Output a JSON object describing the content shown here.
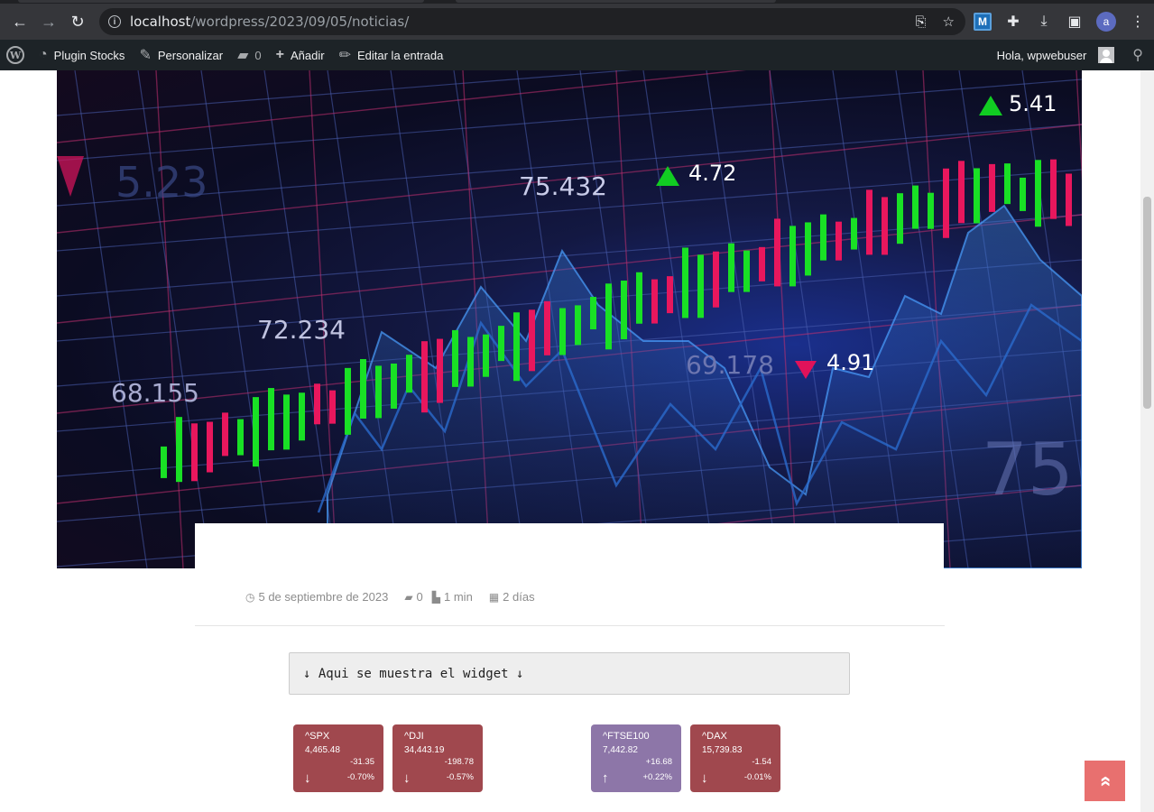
{
  "browser": {
    "url_host": "localhost",
    "url_path": "/wordpress/2023/09/05/noticias/",
    "extension_label": "M",
    "profile_initial": "a"
  },
  "adminbar": {
    "site_name": "Plugin Stocks",
    "customize": "Personalizar",
    "comments_count": "0",
    "add_new": "Añadir",
    "edit_post": "Editar la entrada",
    "greeting": "Hola, wpwebuser"
  },
  "hero": {
    "labels": [
      "5.23",
      "75.432",
      "4.72",
      "5.41",
      "72.234",
      "68.155",
      "69.178",
      "4.91",
      "75"
    ]
  },
  "meta": {
    "date": "5 de septiembre de 2023",
    "comments": "0",
    "read_time": "1 min",
    "age": "2 días"
  },
  "notice": {
    "text": "↓ Aqui se muestra el widget ↓"
  },
  "stocks": [
    {
      "symbol": "^SPX",
      "price": "4,465.48",
      "change": "-31.35",
      "percent": "-0.70%",
      "direction": "down",
      "color": "#a0484e"
    },
    {
      "symbol": "^DJI",
      "price": "34,443.19",
      "change": "-198.78",
      "percent": "-0.57%",
      "direction": "down",
      "color": "#a0484e"
    },
    {
      "symbol": "^FTSE100",
      "price": "7,442.82",
      "change": "+16.68",
      "percent": "+0.22%",
      "direction": "up",
      "color": "#8d76a8"
    },
    {
      "symbol": "^DAX",
      "price": "15,739.83",
      "change": "-1.54",
      "percent": "-0.01%",
      "direction": "down",
      "color": "#a0484e"
    }
  ],
  "icons": {
    "back": "arrow-left-icon",
    "forward": "arrow-right-icon",
    "reload": "reload-icon",
    "share": "share-icon",
    "bookmark": "star-icon",
    "extensions": "puzzle-icon",
    "download": "download-icon",
    "sidepanel": "sidepanel-icon",
    "menu": "kebab-menu-icon",
    "scroll_top": "chevron-double-up-icon"
  }
}
